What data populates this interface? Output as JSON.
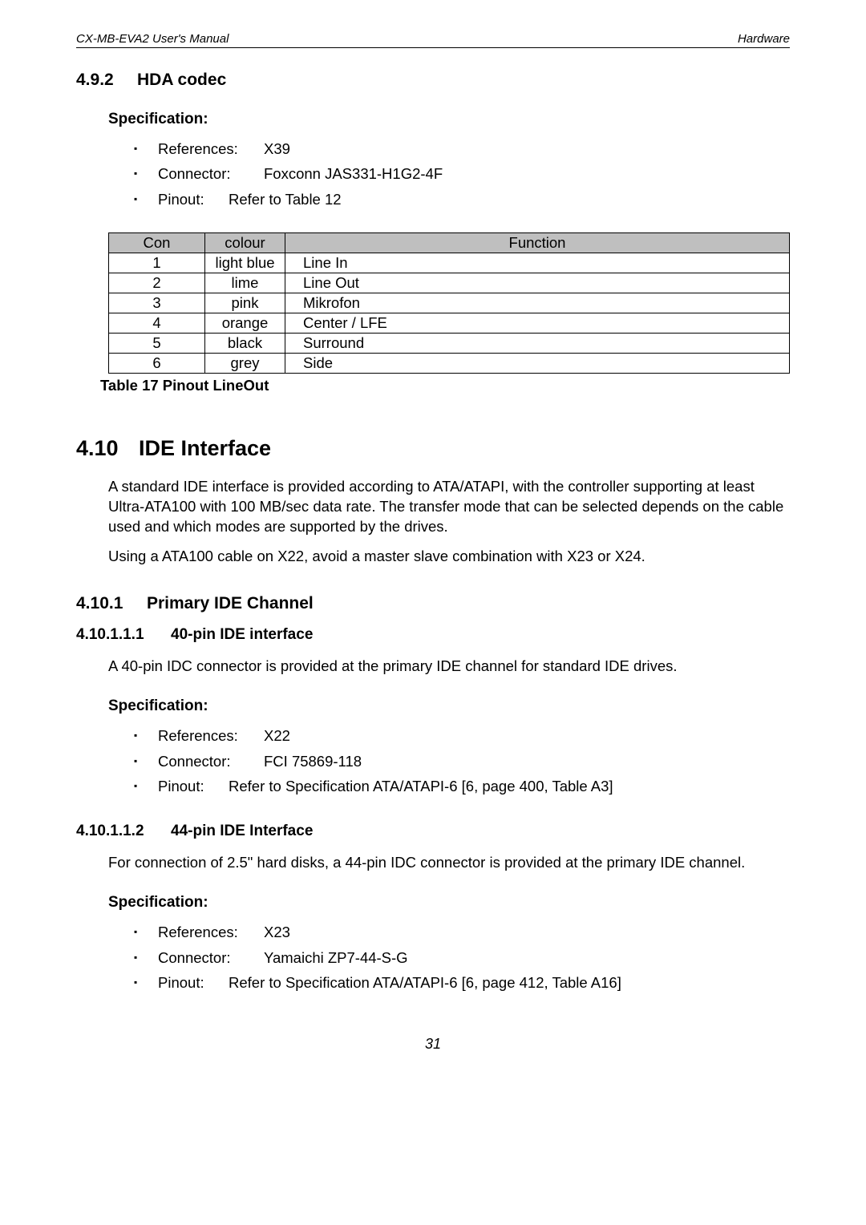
{
  "header": {
    "left": "CX-MB-EVA2  User's Manual",
    "right": "Hardware"
  },
  "sec_492": {
    "num": "4.9.2",
    "title": "HDA codec",
    "spec_title": "Specification:",
    "items": {
      "ref_label": "References:",
      "ref_value": "X39",
      "con_label": "Connector:",
      "con_value": "Foxconn JAS331-H1G2-4F",
      "pin_label": "Pinout:",
      "pin_value": "Refer to Table 12"
    }
  },
  "table17": {
    "headers": {
      "con": "Con",
      "colour": "colour",
      "fn": "Function"
    },
    "rows": [
      {
        "con": "1",
        "colour": "light blue",
        "fn": "Line In"
      },
      {
        "con": "2",
        "colour": "lime",
        "fn": "Line Out"
      },
      {
        "con": "3",
        "colour": "pink",
        "fn": "Mikrofon"
      },
      {
        "con": "4",
        "colour": "orange",
        "fn": "Center / LFE"
      },
      {
        "con": "5",
        "colour": "black",
        "fn": "Surround"
      },
      {
        "con": "6",
        "colour": "grey",
        "fn": "Side"
      }
    ],
    "caption": "Table 17   Pinout LineOut"
  },
  "sec_410": {
    "num": "4.10",
    "title": "IDE Interface",
    "p1": "A standard IDE interface is provided according to ATA/ATAPI, with the controller supporting at least Ultra-ATA100 with 100 MB/sec data rate. The transfer mode that can be selected depends on the cable used and which modes are supported by the drives.",
    "p2": "Using a ATA100 cable on X22, avoid a master slave combination with X23 or X24."
  },
  "sec_4101": {
    "num": "4.10.1",
    "title": "Primary IDE Channel"
  },
  "sec_410111": {
    "num": "4.10.1.1.1",
    "title": "40-pin IDE interface",
    "p1": "A 40-pin IDC connector is provided at the primary IDE channel for standard IDE drives.",
    "spec_title": "Specification:",
    "items": {
      "ref_label": "References:",
      "ref_value": "X22",
      "con_label": "Connector:",
      "con_value": "FCI 75869-118",
      "pin_label": "Pinout:",
      "pin_value": "Refer to Specification ATA/ATAPI-6 [6, page 400, Table A3]"
    }
  },
  "sec_410112": {
    "num": "4.10.1.1.2",
    "title": "44-pin IDE Interface",
    "p1": "For connection of 2.5\" hard disks, a 44-pin IDC connector is provided at the primary IDE channel.",
    "spec_title": "Specification:",
    "items": {
      "ref_label": "References:",
      "ref_value": "X23",
      "con_label": "Connector:",
      "con_value": "Yamaichi ZP7-44-S-G",
      "pin_label": "Pinout:",
      "pin_value": "Refer to Specification ATA/ATAPI-6 [6, page 412, Table A16]"
    }
  },
  "page_number": "31"
}
